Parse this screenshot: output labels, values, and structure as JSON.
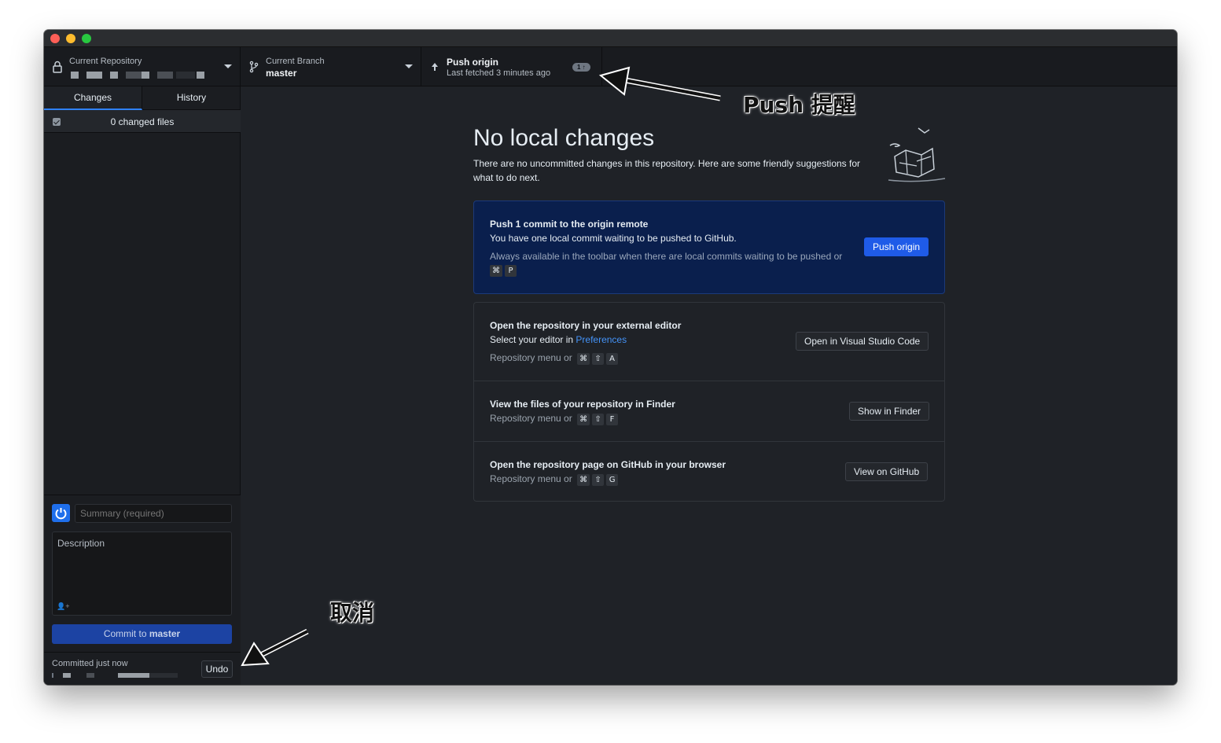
{
  "toolbar": {
    "repo": {
      "label": "Current Repository",
      "name_redacted": true
    },
    "branch": {
      "label": "Current Branch",
      "name": "master"
    },
    "push": {
      "title": "Push origin",
      "subtitle": "Last fetched 3 minutes ago",
      "badge": "1 ↑"
    }
  },
  "sidebar": {
    "tabs": [
      {
        "label": "Changes",
        "active": true
      },
      {
        "label": "History",
        "active": false
      }
    ],
    "changes_count": "0 changed files",
    "commit": {
      "summary_placeholder": "Summary (required)",
      "description_placeholder": "Description",
      "button_prefix": "Commit to ",
      "button_branch": "master"
    },
    "undo": {
      "text": "Committed just now",
      "button": "Undo"
    }
  },
  "main": {
    "title": "No local changes",
    "description": "There are no uncommitted changes in this repository. Here are some friendly suggestions for what to do next.",
    "push_card": {
      "title": "Push 1 commit to the origin remote",
      "description": "You have one local commit waiting to be pushed to GitHub.",
      "hint": "Always available in the toolbar when there are local commits waiting to be pushed or",
      "keys": [
        "⌘",
        "P"
      ],
      "button": "Push origin"
    },
    "actions": [
      {
        "title": "Open the repository in your external editor",
        "desc_prefix": "Select your editor in ",
        "desc_link": "Preferences",
        "hint": "Repository menu or",
        "keys": [
          "⌘",
          "⇧",
          "A"
        ],
        "button": "Open in Visual Studio Code"
      },
      {
        "title": "View the files of your repository in Finder",
        "hint": "Repository menu or",
        "keys": [
          "⌘",
          "⇧",
          "F"
        ],
        "button": "Show in Finder"
      },
      {
        "title": "Open the repository page on GitHub in your browser",
        "hint": "Repository menu or",
        "keys": [
          "⌘",
          "⇧",
          "G"
        ],
        "button": "View on GitHub"
      }
    ]
  },
  "annotations": {
    "push_label": "Push 提醒",
    "undo_label": "取消"
  },
  "colors": {
    "accent": "#1f5be8",
    "window_bg": "#1f2227",
    "push_card_bg": "#0a1f4d"
  }
}
